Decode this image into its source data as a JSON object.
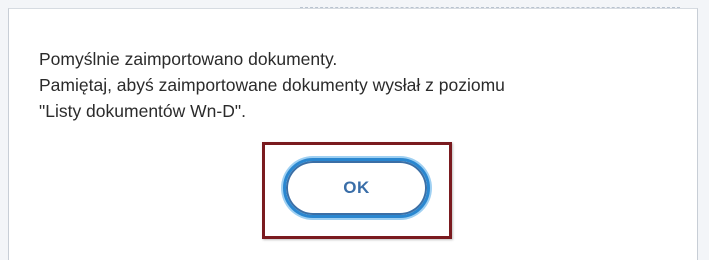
{
  "dialog": {
    "message_lines": [
      "Pomyślnie zaimportowano dokumenty.",
      "Pamiętaj, abyś zaimportowane dokumenty wysłał z poziomu",
      "\"Listy dokumentów Wn-D\"."
    ],
    "ok_label": "OK"
  },
  "colors": {
    "button_border": "#2a87d0",
    "button_text": "#3a6ea8",
    "highlight_border": "#7a1a1f",
    "text": "#2b2b2b"
  }
}
